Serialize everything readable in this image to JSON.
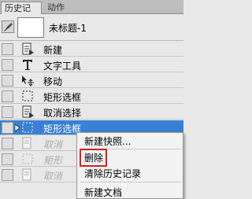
{
  "tabs": [
    {
      "label": "历史记录"
    },
    {
      "label": "动作"
    }
  ],
  "snapshot": {
    "label": "未标题-1"
  },
  "history": [
    {
      "label": "新建",
      "icon": "document-icon"
    },
    {
      "label": "文字工具",
      "icon": "text-tool-icon"
    },
    {
      "label": "移动",
      "icon": "move-tool-icon"
    },
    {
      "label": "矩形选框",
      "icon": "marquee-icon"
    },
    {
      "label": "取消选择",
      "icon": "document-icon"
    },
    {
      "label": "矩形选框",
      "icon": "marquee-icon"
    },
    {
      "label": "取消",
      "icon": "document-icon"
    },
    {
      "label": "矩形",
      "icon": "marquee-icon"
    },
    {
      "label": "取消",
      "icon": "document-icon"
    }
  ],
  "context_menu": {
    "items": [
      {
        "label": "新建快照..."
      },
      {
        "label": "删除"
      },
      {
        "label": "清除历史记录"
      },
      {
        "label": "新建文档"
      }
    ]
  },
  "colors": {
    "selection": "#3a7fd4",
    "highlight": "#d42020"
  }
}
